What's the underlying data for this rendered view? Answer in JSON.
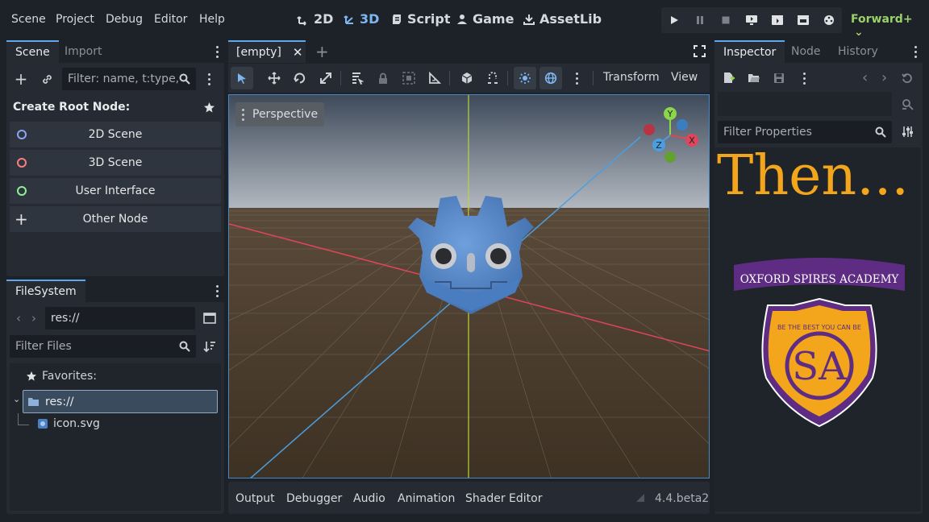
{
  "menu": [
    "Scene",
    "Project",
    "Debug",
    "Editor",
    "Help"
  ],
  "workspaces": [
    {
      "label": "2D",
      "icon": "2d-icon",
      "active": false
    },
    {
      "label": "3D",
      "icon": "3d-icon",
      "active": true
    },
    {
      "label": "Script",
      "icon": "script-icon",
      "active": false
    },
    {
      "label": "Game",
      "icon": "game-icon",
      "active": false
    },
    {
      "label": "AssetLib",
      "icon": "download-icon",
      "active": false
    }
  ],
  "renderer": "Forward+",
  "scene_dock": {
    "tabs": [
      "Scene",
      "Import"
    ],
    "filter_placeholder": "Filter: name, t:type,",
    "create_root_label": "Create Root Node:",
    "root_buttons": [
      {
        "label": "2D Scene",
        "color": "#8da5f3"
      },
      {
        "label": "3D Scene",
        "color": "#fc7f7f"
      },
      {
        "label": "User Interface",
        "color": "#8eef97"
      },
      {
        "label": "Other Node",
        "color": "#e0e0e0"
      }
    ]
  },
  "filesystem": {
    "tab": "FileSystem",
    "path": "res://",
    "filter_placeholder": "Filter Files",
    "favorites_label": "Favorites:",
    "root_folder": "res://",
    "files": [
      "icon.svg"
    ]
  },
  "editor": {
    "scene_tab": "[empty]",
    "perspective_label": "Perspective",
    "transform_menu": "Transform",
    "view_menu": "View",
    "gizmo_axes": [
      "Y",
      "X",
      "Z"
    ]
  },
  "bottom_panel": {
    "tabs": [
      "Output",
      "Debugger",
      "Audio",
      "Animation",
      "Shader Editor"
    ],
    "version": "4.4.beta2"
  },
  "inspector": {
    "tabs": [
      "Inspector",
      "Node",
      "History"
    ],
    "filter_placeholder": "Filter Properties",
    "overlay_text": "Then...",
    "school_name": "OXFORD SPIRES ACADEMY",
    "motto": "BE THE BEST YOU CAN BE",
    "crest_letters": "SA"
  }
}
